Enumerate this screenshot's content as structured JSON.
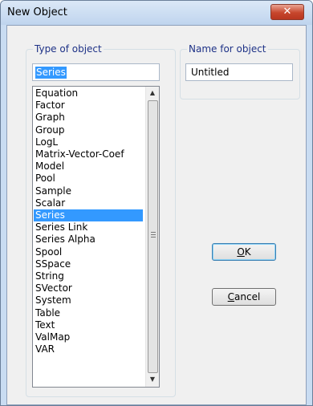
{
  "window": {
    "title": "New Object",
    "close_glyph": "✕"
  },
  "type_group": {
    "label": "Type of object",
    "input_value": "Series",
    "items": [
      "Equation",
      "Factor",
      "Graph",
      "Group",
      "LogL",
      "Matrix-Vector-Coef",
      "Model",
      "Pool",
      "Sample",
      "Scalar",
      "Series",
      "Series Link",
      "Series Alpha",
      "Spool",
      "SSpace",
      "String",
      "SVector",
      "System",
      "Table",
      "Text",
      "ValMap",
      "VAR"
    ],
    "selected_index": 10
  },
  "name_group": {
    "label": "Name for object",
    "input_value": "Untitled"
  },
  "buttons": {
    "ok": {
      "mnemonic": "O",
      "rest": "K"
    },
    "cancel": {
      "mnemonic": "C",
      "rest": "ancel"
    }
  },
  "colors": {
    "selection": "#3399ff",
    "group_label": "#1e3287"
  },
  "icons": {
    "close": "close-icon",
    "scroll_up": "scroll-up-arrow-icon",
    "scroll_down": "scroll-down-arrow-icon"
  }
}
